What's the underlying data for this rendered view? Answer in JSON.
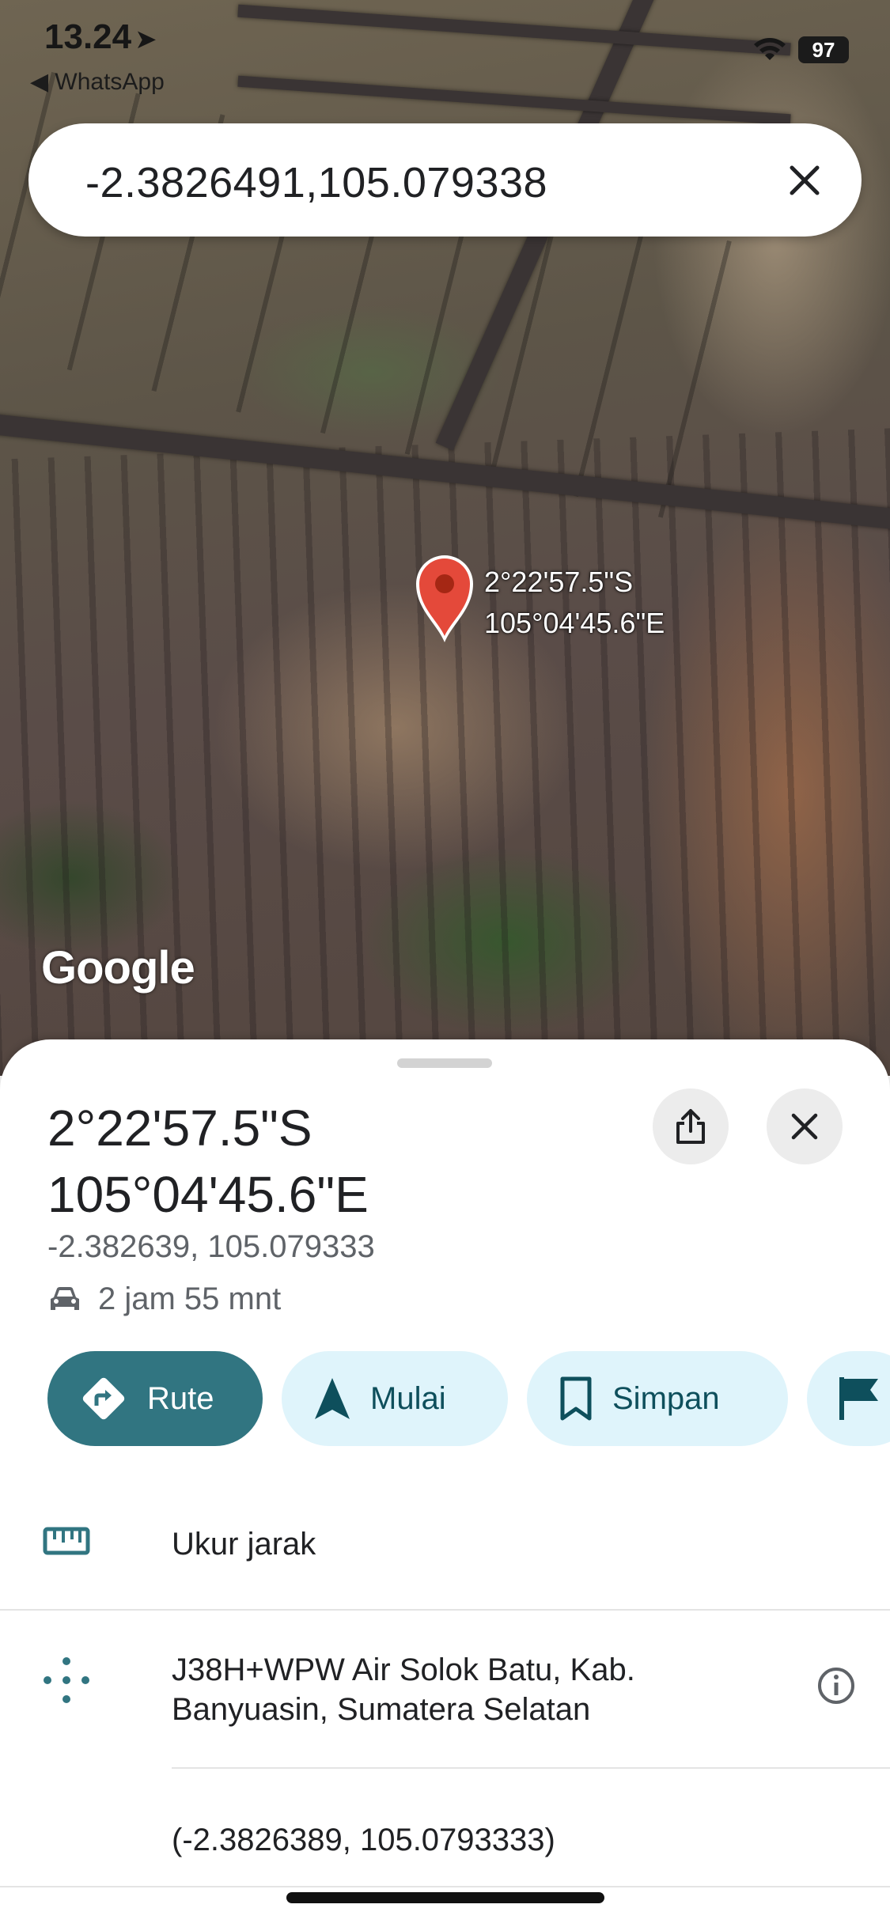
{
  "status_bar": {
    "time": "13.24",
    "back_app": "◀ WhatsApp",
    "battery": "97"
  },
  "search": {
    "query": "-2.3826491,105.079338"
  },
  "map": {
    "pin_label_lat": "2°22'57.5\"S",
    "pin_label_lng": "105°04'45.6\"E",
    "attribution": "Google",
    "pin_color": "#e4493a"
  },
  "place": {
    "title_lat": "2°22'57.5\"S",
    "title_lng": "105°04'45.6\"E",
    "coords": "-2.382639, 105.079333",
    "drive_time": "2 jam 55 mnt"
  },
  "actions": {
    "route": "Rute",
    "start": "Mulai",
    "save": "Simpan"
  },
  "rows": {
    "measure": "Ukur jarak",
    "plus_code": "J38H+WPW Air Solok Batu, Kab. Banyuasin, Sumatera Selatan",
    "decimal": "(-2.3826389, 105.0793333)"
  },
  "colors": {
    "primary": "#317581",
    "chip_light": "#dff4fb",
    "chip_text": "#0e4f5c"
  }
}
